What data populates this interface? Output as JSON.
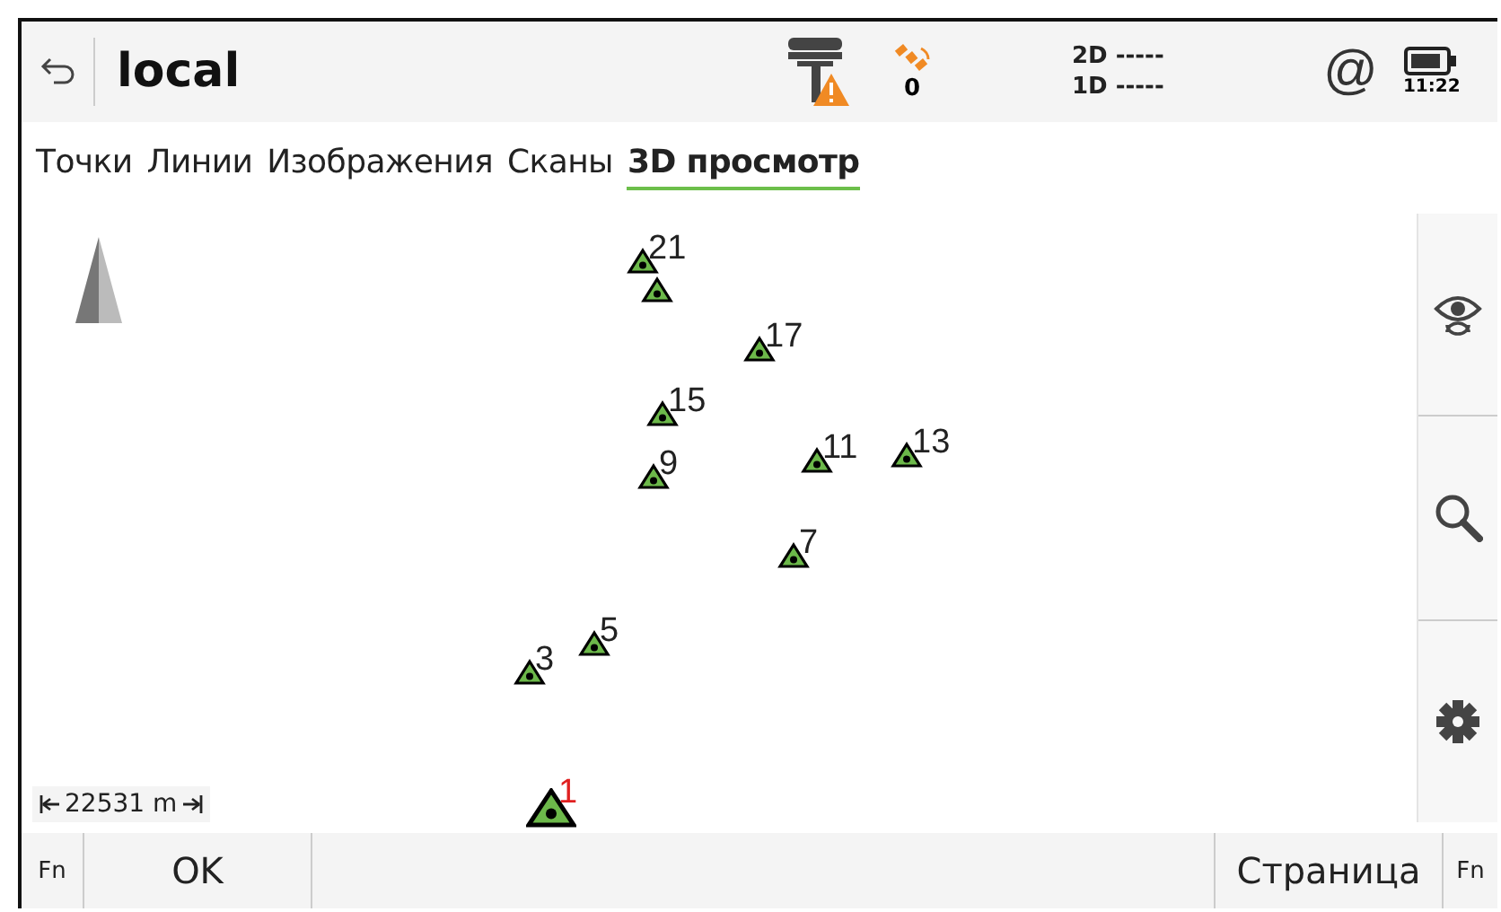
{
  "header": {
    "title": "local",
    "instrument_warning": true,
    "satellites": "0",
    "status_2d": "2D -----",
    "status_1d": "1D -----",
    "at_symbol": "@",
    "time": "11:22"
  },
  "tabs": [
    {
      "label": "Точки",
      "selected": false
    },
    {
      "label": "Линии",
      "selected": false
    },
    {
      "label": "Изображения",
      "selected": false
    },
    {
      "label": "Сканы",
      "selected": false
    },
    {
      "label": "3D просмотр",
      "selected": true
    }
  ],
  "map": {
    "scale": "22531 m",
    "points": [
      {
        "label": "21",
        "highlighted": false
      },
      {
        "highlighted": false
      },
      {
        "label": "17",
        "highlighted": false
      },
      {
        "label": "15",
        "highlighted": false
      },
      {
        "label": "9",
        "highlighted": false
      },
      {
        "label": "11",
        "highlighted": false
      },
      {
        "label": "13",
        "highlighted": false
      },
      {
        "label": "7",
        "highlighted": false
      },
      {
        "label": "5",
        "highlighted": false
      },
      {
        "label": "3",
        "highlighted": false
      },
      {
        "label": "1",
        "highlighted": true
      }
    ]
  },
  "bottom_bar": {
    "left_fn": "Fn",
    "ok": "OK",
    "page": "Страница",
    "right_fn": "Fn"
  }
}
